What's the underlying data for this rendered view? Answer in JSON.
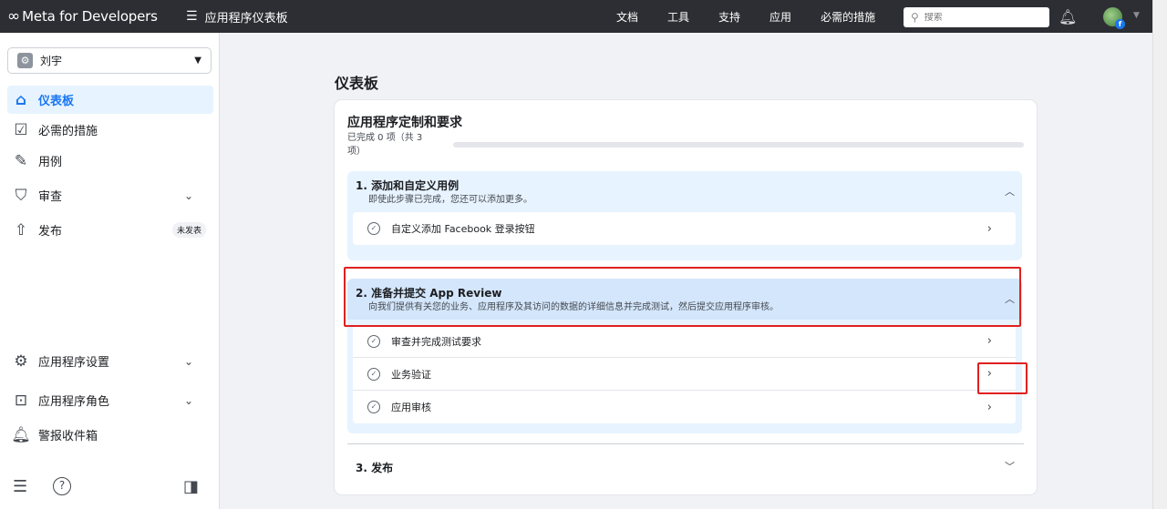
{
  "topbar": {
    "brand": "Meta for Developers",
    "app_dashboard": "应用程序仪表板",
    "nav": [
      "文档",
      "工具",
      "支持",
      "应用",
      "必需的措施"
    ],
    "search_placeholder": "搜索"
  },
  "sidebar": {
    "app_name": "刘宇",
    "items": [
      {
        "label": "仪表板",
        "icon": "home-icon"
      },
      {
        "label": "必需的措施",
        "icon": "checklist-icon"
      },
      {
        "label": "用例",
        "icon": "pencil-icon"
      },
      {
        "label": "审查",
        "icon": "shield-icon"
      },
      {
        "label": "发布",
        "icon": "upload-icon",
        "badge": "未发表"
      },
      {
        "label": "应用程序设置",
        "icon": "gear-icon"
      },
      {
        "label": "应用程序角色",
        "icon": "person-card-icon"
      },
      {
        "label": "警报收件箱",
        "icon": "bell-icon"
      }
    ]
  },
  "main": {
    "page_title": "仪表板",
    "card": {
      "title": "应用程序定制和要求",
      "progress_text": "已完成 0 项（共 3 项）",
      "progress_fraction": 0,
      "sections": [
        {
          "title": "1. 添加和自定义用例",
          "description": "即使此步骤已完成，您还可以添加更多。",
          "tasks": [
            "自定义添加 Facebook 登录按钮"
          ]
        },
        {
          "title": "2. 准备并提交 App Review",
          "description": "向我们提供有关您的业务、应用程序及其访问的数据的详细信息并完成测试，然后提交应用程序审核。",
          "tasks": [
            "审查并完成测试要求",
            "业务验证",
            "应用审核"
          ]
        },
        {
          "title": "3. 发布"
        }
      ]
    }
  },
  "colors": {
    "accent": "#1877f2",
    "topbar_bg": "#2d2e33",
    "annotation_red": "#e02020"
  }
}
